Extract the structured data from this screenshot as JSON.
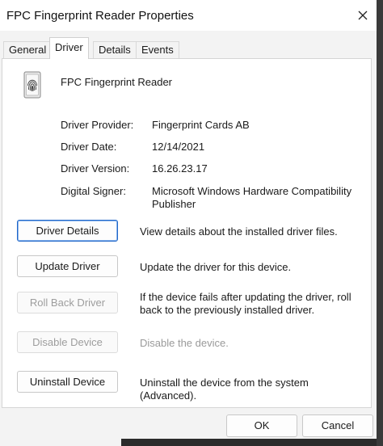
{
  "window": {
    "title": "FPC Fingerprint Reader Properties"
  },
  "tabs": [
    {
      "label": "General"
    },
    {
      "label": "Driver"
    },
    {
      "label": "Details"
    },
    {
      "label": "Events"
    }
  ],
  "device": {
    "name": "FPC Fingerprint Reader",
    "icon": "fingerprint-device-icon"
  },
  "properties": [
    {
      "label": "Driver Provider:",
      "value": "Fingerprint Cards AB"
    },
    {
      "label": "Driver Date:",
      "value": "12/14/2021"
    },
    {
      "label": "Driver Version:",
      "value": "16.26.23.17"
    },
    {
      "label": "Digital Signer:",
      "value": "Microsoft Windows Hardware Compatibility Publisher"
    }
  ],
  "actions": [
    {
      "label": "Driver Details",
      "description": "View details about the installed driver files."
    },
    {
      "label": "Update Driver",
      "description": "Update the driver for this device."
    },
    {
      "label": "Roll Back Driver",
      "description": "If the device fails after updating the driver, roll back to the previously installed driver."
    },
    {
      "label": "Disable Device",
      "description": "Disable the device."
    },
    {
      "label": "Uninstall Device",
      "description": "Uninstall the device from the system (Advanced)."
    }
  ],
  "footer": {
    "ok_label": "OK",
    "cancel_label": "Cancel"
  },
  "colors": {
    "focus_border": "#1f66c8",
    "disabled_text": "#9d9d9d"
  }
}
